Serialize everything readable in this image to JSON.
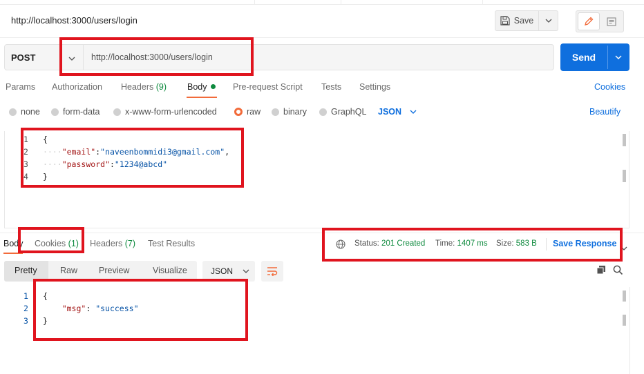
{
  "header": {
    "title": "http://localhost:3000/users/login",
    "save_label": "Save"
  },
  "request": {
    "method": "POST",
    "url": "http://localhost:3000/users/login",
    "send_label": "Send"
  },
  "request_tabs": {
    "params": "Params",
    "authorization": "Authorization",
    "headers": "Headers",
    "headers_count": "(9)",
    "body": "Body",
    "prerequest": "Pre-request Script",
    "tests": "Tests",
    "settings": "Settings",
    "cookies": "Cookies"
  },
  "body_types": {
    "none": "none",
    "form_data": "form-data",
    "urlencoded": "x-www-form-urlencoded",
    "raw": "raw",
    "binary": "binary",
    "graphql": "GraphQL",
    "selected_format": "JSON",
    "beautify": "Beautify"
  },
  "request_body": {
    "line_numbers": [
      "1",
      "2",
      "3",
      "4"
    ],
    "open_brace": "{",
    "close_brace": "}",
    "email_key": "\"email\"",
    "email_value": "\"naveenbommidi3@gmail.com\"",
    "password_key": "\"password\"",
    "password_value": "\"1234@abcd\""
  },
  "response_tabs": {
    "body": "Body",
    "cookies": "Cookies",
    "cookies_count": "(1)",
    "headers": "Headers",
    "headers_count": "(7)",
    "test_results": "Test Results"
  },
  "response_status": {
    "status_label": "Status:",
    "status_value": "201 Created",
    "time_label": "Time:",
    "time_value": "1407 ms",
    "size_label": "Size:",
    "size_value": "583 B",
    "save_response": "Save Response"
  },
  "response_view": {
    "pretty": "Pretty",
    "raw": "Raw",
    "preview": "Preview",
    "visualize": "Visualize",
    "format": "JSON"
  },
  "response_body": {
    "line_numbers": [
      "1",
      "2",
      "3"
    ],
    "open_brace": "{",
    "close_brace": "}",
    "msg_key": "\"msg\"",
    "msg_value": "\"success\""
  },
  "colors": {
    "accent": "#0f6fde",
    "active_tab": "#f26b3a",
    "success": "#0e8a3e",
    "highlight_box": "#e0141e"
  }
}
